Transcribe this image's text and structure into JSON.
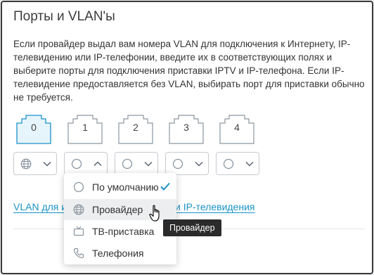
{
  "title": "Порты и VLAN'ы",
  "description": "Если провайдер выдал вам номера VLAN для подключения к Интернету, IP-телевидению или IP-телефонии, введите их в соответствующих полях и выберите порты для подключения приставки IPTV и IP-телефона. Если IP-телевидение предоставляется без VLAN, выбирать порт для приставки обычно не требуется.",
  "ports": [
    {
      "label": "0",
      "active": true
    },
    {
      "label": "1",
      "active": false
    },
    {
      "label": "2",
      "active": false
    },
    {
      "label": "3",
      "active": false
    },
    {
      "label": "4",
      "active": false
    }
  ],
  "selects": [
    {
      "icon": "globe-icon",
      "open": false
    },
    {
      "icon": "circle-icon",
      "open": true
    },
    {
      "icon": "circle-icon",
      "open": false
    },
    {
      "icon": "circle-icon",
      "open": false
    },
    {
      "icon": "circle-icon",
      "open": false
    }
  ],
  "links": {
    "vlan_left": "VLAN для и",
    "vlan_right": "и IP-телевидения"
  },
  "menu": {
    "items": [
      {
        "label": "По умолчанию",
        "icon": "circle-icon",
        "selected": true
      },
      {
        "label": "Провайдер",
        "icon": "globe-icon",
        "hovered": true
      },
      {
        "label": "ТВ-приставка",
        "icon": "tv-icon"
      },
      {
        "label": "Телефония",
        "icon": "phone-icon"
      }
    ]
  },
  "tooltip": "Провайдер",
  "colors": {
    "accent": "#1a92c8",
    "active_port_fill": "#e6f4fb",
    "icon": "#8c96a0"
  }
}
